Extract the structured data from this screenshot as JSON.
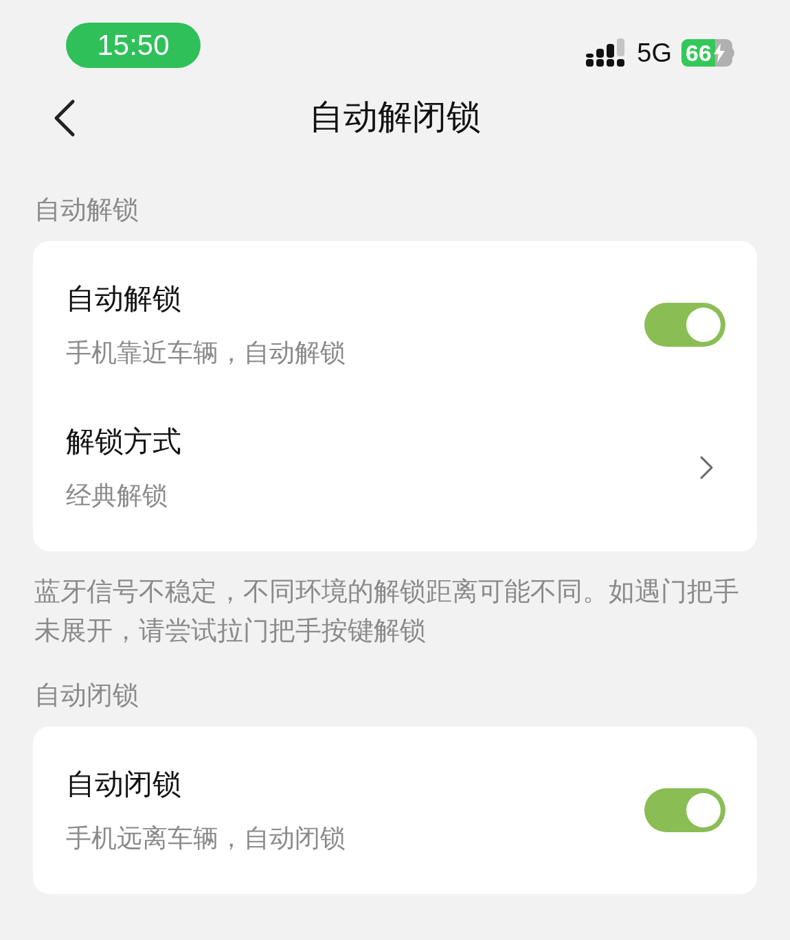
{
  "status_bar": {
    "time": "15:50",
    "network": "5G",
    "battery": "66"
  },
  "nav": {
    "title": "自动解闭锁"
  },
  "sections": [
    {
      "header": "自动解锁",
      "rows": [
        {
          "kind": "toggle",
          "title": "自动解锁",
          "subtitle": "手机靠近车辆，自动解锁",
          "on": true
        },
        {
          "kind": "link",
          "title": "解锁方式",
          "subtitle": "经典解锁"
        }
      ],
      "note": "蓝牙信号不稳定，不同环境的解锁距离可能不同。如遇门把手未展开，请尝试拉门把手按键解锁"
    },
    {
      "header": "自动闭锁",
      "rows": [
        {
          "kind": "toggle",
          "title": "自动闭锁",
          "subtitle": "手机远离车辆，自动闭锁",
          "on": true
        }
      ]
    }
  ]
}
